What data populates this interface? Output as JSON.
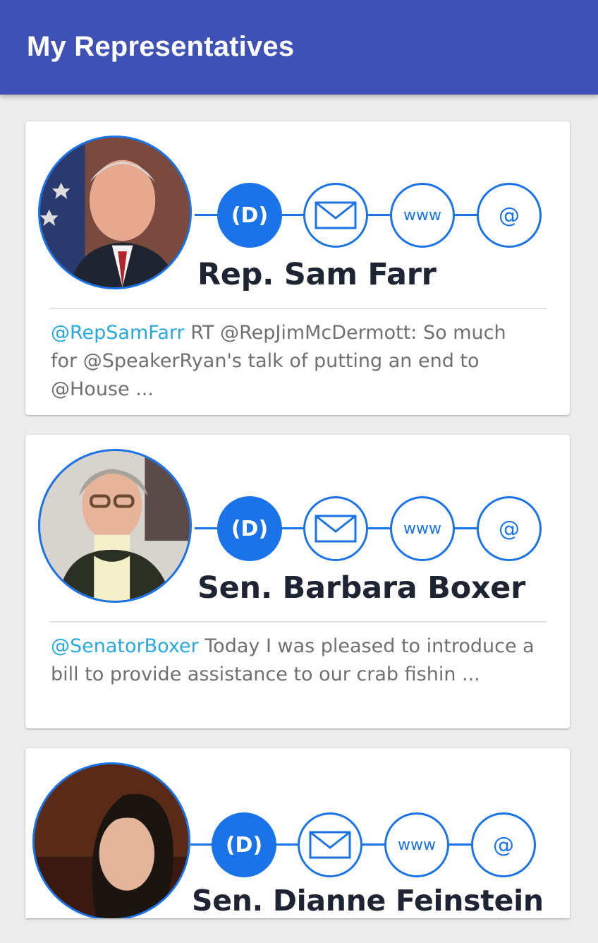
{
  "appbar": {
    "title": "My Representatives",
    "color": "#3f51b5"
  },
  "accent_color": "#1a73e8",
  "handle_color": "#29a8e0",
  "representatives": [
    {
      "name": "Rep. Sam Farr",
      "party": "(D)",
      "web_label": "www",
      "at_label": "@",
      "tweet_handle": "@RepSamFarr",
      "tweet_text": " RT @RepJimMcDermott: So much for @SpeakerRyan's talk of putting an end to @House ..."
    },
    {
      "name": "Sen. Barbara Boxer",
      "party": "(D)",
      "web_label": "www",
      "at_label": "@",
      "tweet_handle": "@SenatorBoxer",
      "tweet_text": " Today I was pleased to introduce a bill to provide assistance to our crab fishin ..."
    },
    {
      "name": "Sen. Dianne Feinstein",
      "party": "(D)",
      "web_label": "www",
      "at_label": "@"
    }
  ]
}
